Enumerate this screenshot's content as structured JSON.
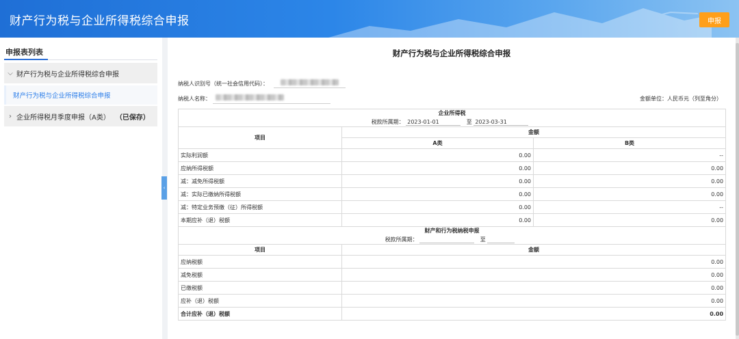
{
  "header": {
    "title": "财产行为税与企业所得税综合申报",
    "submit_label": "申报"
  },
  "sidebar": {
    "title": "申报表列表",
    "groups": [
      {
        "label": "财产行为税与企业所得税综合申报",
        "expanded": true,
        "children": [
          {
            "label": "财产行为税与企业所得税综合申报",
            "active": true
          }
        ]
      },
      {
        "label": "企业所得税月季度申报（A类）",
        "status": "（已保存）",
        "expanded": false
      }
    ]
  },
  "form": {
    "title": "财产行为税与企业所得税综合申报",
    "taxpayer_id_label": "纳税人识别号（统一社会信用代码）：",
    "taxpayer_name_label": "纳税人名称：",
    "currency_unit": "金额单位：人民币元（列至角分）",
    "cit": {
      "section_title": "企业所得税",
      "period_label": "税款所属期：",
      "period_from": "2023-01-01",
      "period_to_sep": "至",
      "period_to": "2023-03-31",
      "item_header": "项目",
      "amount_header": "金额",
      "col_a": "A类",
      "col_b": "B类",
      "rows": [
        {
          "label": "实际利润额",
          "a": "0.00",
          "b": "--"
        },
        {
          "label": "应纳所得税额",
          "a": "0.00",
          "b": "0.00"
        },
        {
          "label": "减：减免所得税额",
          "a": "0.00",
          "b": "0.00"
        },
        {
          "label": "减：实际已缴纳所得税额",
          "a": "0.00",
          "b": "0.00"
        },
        {
          "label": "减：特定业务预缴（征）所得税额",
          "a": "0.00",
          "b": "--"
        },
        {
          "label": "本期应补（退）税额",
          "a": "0.00",
          "b": "0.00"
        }
      ]
    },
    "property": {
      "section_title": "财产和行为税纳税申报",
      "period_label": "税款所属期：",
      "period_to_sep": "至",
      "item_header": "项目",
      "amount_header": "金额",
      "rows": [
        {
          "label": "应纳税额",
          "amount": "0.00"
        },
        {
          "label": "减免税额",
          "amount": "0.00"
        },
        {
          "label": "已缴税额",
          "amount": "0.00"
        },
        {
          "label": "应补（退）税额",
          "amount": "0.00"
        }
      ],
      "total": {
        "label": "合计应补（退）税额",
        "amount": "0.00"
      }
    }
  },
  "colors": {
    "header_start": "#1f6fd6",
    "submit_button": "#ff9f1a",
    "active_link": "#2b7de9"
  }
}
